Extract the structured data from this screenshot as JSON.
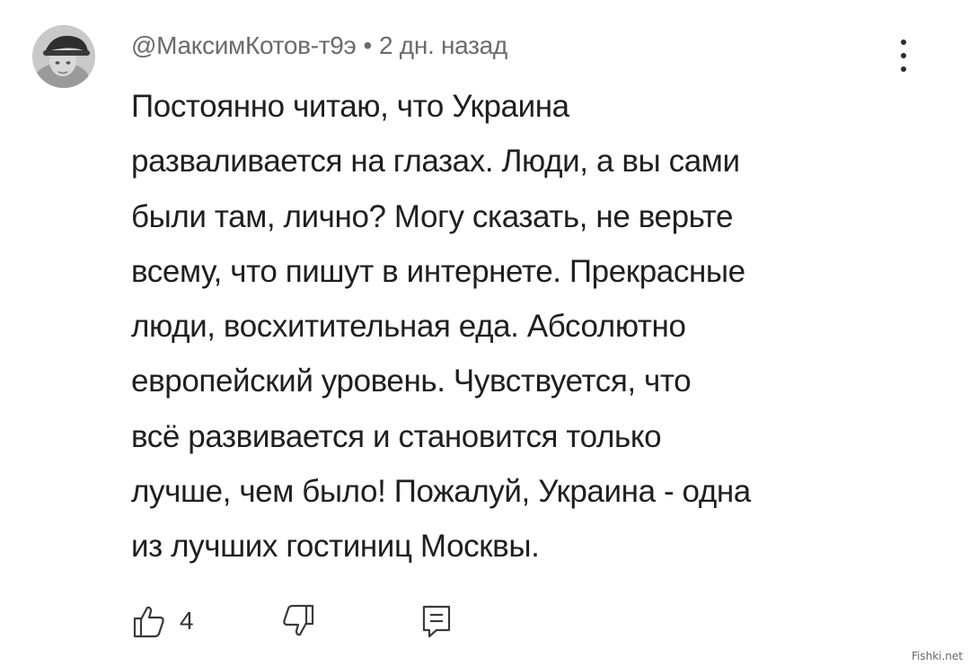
{
  "comment": {
    "author": "@МаксимКотов-т9э",
    "separator": "•",
    "timestamp": "2 дн. назад",
    "text_lines": [
      "Постоянно читаю, что Украина",
      "разваливается на глазах. Люди, а вы сами",
      "были там, лично? Могу сказать, не верьте",
      "всему, что пишут в интернете. Прекрасные",
      "люди, восхитительная еда. Абсолютно",
      "европейский уровень. Чувствуется, что",
      "всё развивается и становится только",
      "лучше, чем было! Пожалуй, Украина - одна",
      "из лучших гостиниц Москвы."
    ],
    "like_count": "4"
  },
  "icons": {
    "avatar": "avatar-image",
    "menu": "more-vert-icon",
    "like": "thumbs-up-icon",
    "dislike": "thumbs-down-icon",
    "reply": "reply-icon"
  },
  "watermark": "Fishki.net"
}
